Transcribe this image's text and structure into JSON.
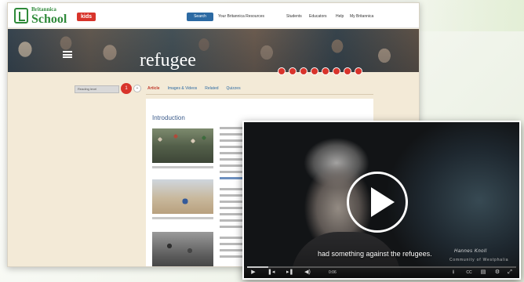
{
  "header": {
    "brand_top": "Britannica",
    "brand_main": "School",
    "badge": "kids",
    "search_label": "Search",
    "nav_items": [
      "Your Britannica Resources",
      "Students",
      "Educators",
      "Help",
      "My Britannica"
    ]
  },
  "banner": {
    "title": "refugee",
    "tool_icons": [
      "print-icon",
      "cite-icon",
      "share-icon",
      "email-icon",
      "save-icon",
      "audio-icon",
      "read-icon",
      "translate-icon"
    ]
  },
  "sidebar": {
    "select_value": "Reading level",
    "go_label": "1"
  },
  "tabs": [
    "Article",
    "Images & Videos",
    "Related",
    "Quizzes"
  ],
  "article": {
    "heading": "Introduction"
  },
  "video": {
    "subtitle": "had something against the refugees.",
    "speaker_name": "Hannes Knoll",
    "speaker_role": "Community of Westphalia",
    "progress": 0.08,
    "time_label": "0:06",
    "controls": [
      "play-icon",
      "skip-back-icon",
      "skip-forward-icon",
      "volume-icon"
    ],
    "right_controls": [
      "download-icon",
      "cc-icon",
      "transcript-icon",
      "settings-icon",
      "fullscreen-icon"
    ]
  },
  "colors": {
    "brand_green": "#2f8a3a",
    "accent_red": "#d8342b",
    "link_blue": "#2c6aa3"
  }
}
